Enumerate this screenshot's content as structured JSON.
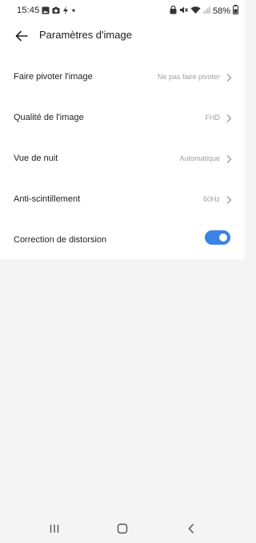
{
  "status_bar": {
    "time": "15:45",
    "battery_percent": "58%"
  },
  "header": {
    "title": "Paramètres d'image"
  },
  "settings": {
    "rows": [
      {
        "label": "Faire pivoter l'image",
        "value": "Ne pas faire pivoter"
      },
      {
        "label": "Qualité de l'image",
        "value": "FHD"
      },
      {
        "label": "Vue de nuit",
        "value": "Automatique"
      },
      {
        "label": "Anti-scintillement",
        "value": "60Hz"
      },
      {
        "label": "Correction de distorsion",
        "toggle_on": true
      }
    ]
  },
  "colors": {
    "toggle_on": "#3b82e6",
    "value_text": "#a0a0a0",
    "background": "#f4f4f4"
  },
  "icons": {
    "status_left": [
      "gallery-icon",
      "camera-icon",
      "bolt-icon",
      "dot-icon"
    ],
    "status_right": [
      "lock-icon",
      "mute-icon",
      "wifi-icon",
      "signal-icon",
      "battery-icon"
    ],
    "nav": [
      "recent-apps-icon",
      "home-icon",
      "back-icon"
    ]
  }
}
